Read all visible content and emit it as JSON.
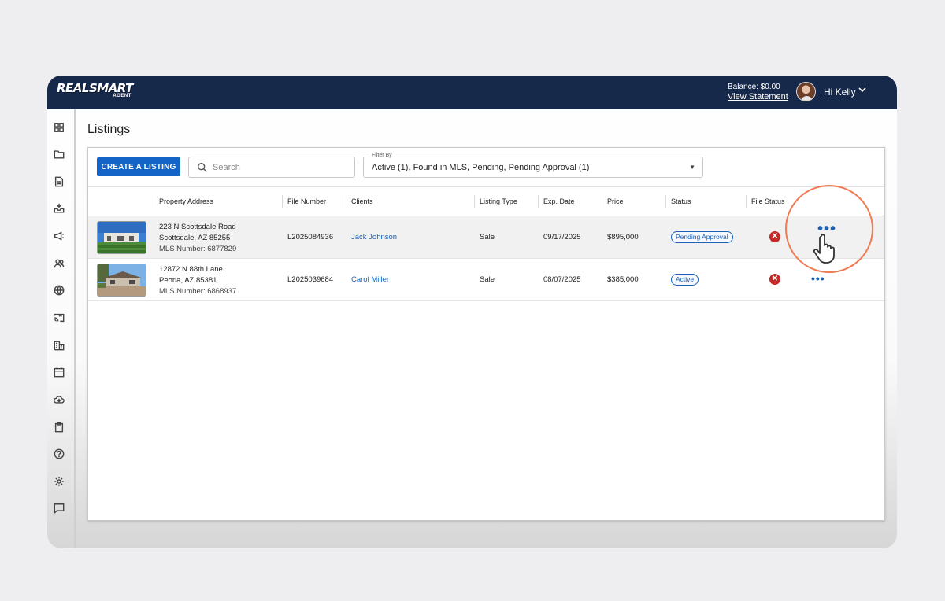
{
  "brand": {
    "name": "REALSMART",
    "sub": "AGENT"
  },
  "account": {
    "balance": "Balance: $0.00",
    "statement_link": "View Statement",
    "greeting": "Hi Kelly"
  },
  "sidebar": {
    "items": [
      "dashboard-icon",
      "folder-icon",
      "document-icon",
      "inbox-icon",
      "megaphone-icon",
      "people-icon",
      "globe-icon",
      "cast-icon",
      "building-icon",
      "calendar-icon",
      "cloud-download-icon",
      "clipboard-icon",
      "help-icon",
      "settings-icon",
      "chat-icon"
    ]
  },
  "page": {
    "title": "Listings"
  },
  "toolbar": {
    "create_label": "CREATE A LISTING",
    "search_placeholder": "Search",
    "filter_label": "Filter By",
    "filter_value": "Active (1), Found in MLS, Pending, Pending Approval (1)"
  },
  "table": {
    "columns": [
      "Property Address",
      "File Number",
      "Clients",
      "Listing Type",
      "Exp. Date",
      "Price",
      "Status",
      "File Status"
    ],
    "rows": [
      {
        "street": "223 N Scottsdale Road",
        "city": "Scottsdale, AZ 85255",
        "mls": "MLS Number: 6877829",
        "file_number": "L2025084936",
        "client": "Jack Johnson",
        "type": "Sale",
        "exp": "09/17/2025",
        "price": "$895,000",
        "status": "Pending Approval",
        "file_status": "✕"
      },
      {
        "street": "12872 N 88th Lane",
        "city": "Peoria, AZ 85381",
        "mls": "MLS Number: 6868937",
        "file_number": "L2025039684",
        "client": "Carol Miller",
        "type": "Sale",
        "exp": "08/07/2025",
        "price": "$385,000",
        "status": "Active",
        "file_status": "✕"
      }
    ],
    "more_label": "•••"
  },
  "colors": {
    "topbar": "#17294b",
    "primary": "#1464c8",
    "link": "#1a62b8",
    "error": "#c62828",
    "highlight": "#f07b55"
  }
}
